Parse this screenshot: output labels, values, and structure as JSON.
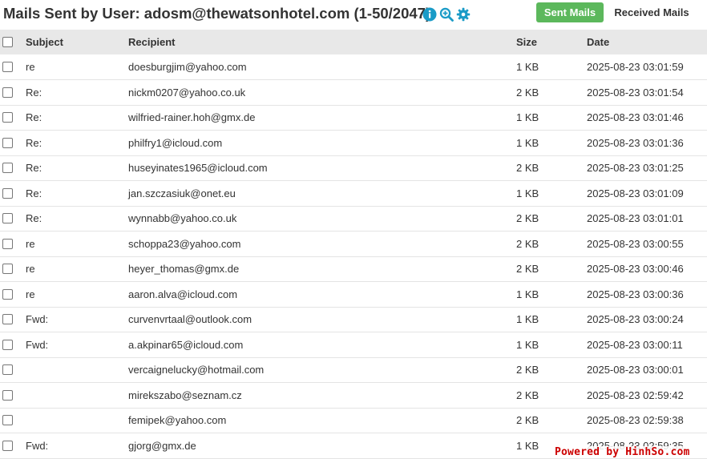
{
  "header": {
    "title": "Mails Sent by User: adosm@thewatsonhotel.com (1-50/2047)",
    "sent_label": "Sent Mails",
    "received_label": "Received Mails",
    "accent": "#5cb85c",
    "icon_color": "#1a9bc7"
  },
  "table": {
    "columns": [
      "Subject",
      "Recipient",
      "Size",
      "Date"
    ],
    "rows": [
      {
        "subject": "re",
        "recipient": "doesburgjim@yahoo.com",
        "size": "1 KB",
        "date": "2025-08-23 03:01:59"
      },
      {
        "subject": "Re:",
        "recipient": "nickm0207@yahoo.co.uk",
        "size": "2 KB",
        "date": "2025-08-23 03:01:54"
      },
      {
        "subject": "Re:",
        "recipient": "wilfried-rainer.hoh@gmx.de",
        "size": "1 KB",
        "date": "2025-08-23 03:01:46"
      },
      {
        "subject": "Re:",
        "recipient": "philfry1@icloud.com",
        "size": "1 KB",
        "date": "2025-08-23 03:01:36"
      },
      {
        "subject": "Re:",
        "recipient": "huseyinates1965@icloud.com",
        "size": "2 KB",
        "date": "2025-08-23 03:01:25"
      },
      {
        "subject": "Re:",
        "recipient": "jan.szczasiuk@onet.eu",
        "size": "1 KB",
        "date": "2025-08-23 03:01:09"
      },
      {
        "subject": "Re:",
        "recipient": "wynnabb@yahoo.co.uk",
        "size": "2 KB",
        "date": "2025-08-23 03:01:01"
      },
      {
        "subject": "re",
        "recipient": "schoppa23@yahoo.com",
        "size": "2 KB",
        "date": "2025-08-23 03:00:55"
      },
      {
        "subject": "re",
        "recipient": "heyer_thomas@gmx.de",
        "size": "2 KB",
        "date": "2025-08-23 03:00:46"
      },
      {
        "subject": "re",
        "recipient": "aaron.alva@icloud.com",
        "size": "1 KB",
        "date": "2025-08-23 03:00:36"
      },
      {
        "subject": "Fwd:",
        "recipient": "curvenvrtaal@outlook.com",
        "size": "1 KB",
        "date": "2025-08-23 03:00:24"
      },
      {
        "subject": "Fwd:",
        "recipient": "a.akpinar65@icloud.com",
        "size": "1 KB",
        "date": "2025-08-23 03:00:11"
      },
      {
        "subject": "",
        "recipient": "vercaignelucky@hotmail.com",
        "size": "2 KB",
        "date": "2025-08-23 03:00:01"
      },
      {
        "subject": "",
        "recipient": "mirekszabo@seznam.cz",
        "size": "2 KB",
        "date": "2025-08-23 02:59:42"
      },
      {
        "subject": "",
        "recipient": "femipek@yahoo.com",
        "size": "2 KB",
        "date": "2025-08-23 02:59:38"
      },
      {
        "subject": "Fwd:",
        "recipient": "gjorg@gmx.de",
        "size": "1 KB",
        "date": "2025-08-23 02:59:35"
      }
    ]
  },
  "icons": [
    "info-icon",
    "zoom-in-icon",
    "gear-icon"
  ],
  "watermark": "Powered by HinhSo.com"
}
